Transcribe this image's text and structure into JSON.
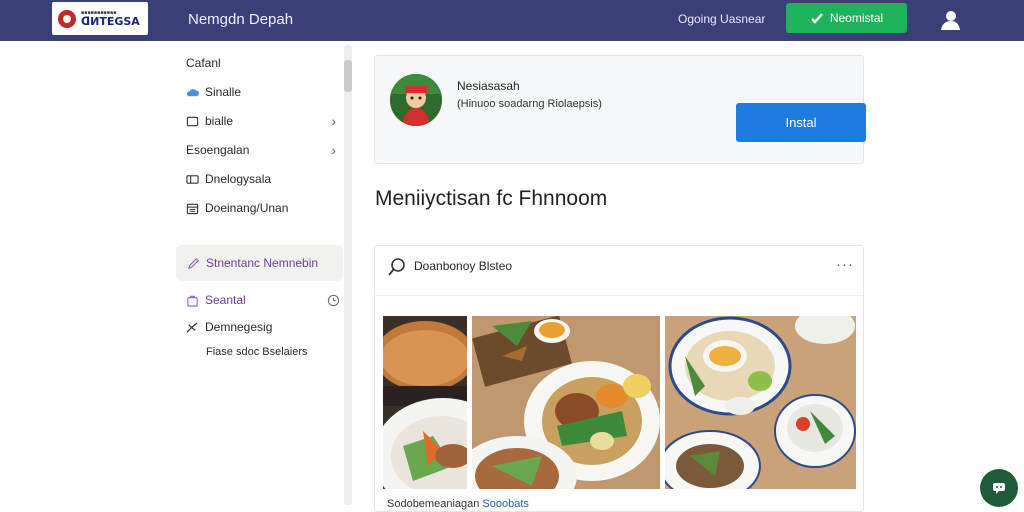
{
  "header": {
    "logo_small": "■■■■■■■■■■■",
    "logo_text": "ᗡИTEGSA",
    "title": "Nemgdn Depah",
    "link": "Ogoing Uasnear",
    "install_label": "Neomistal"
  },
  "sidebar": {
    "items": [
      {
        "label": "Cafanl"
      },
      {
        "label": "Sinalle",
        "icon": "cloud-icon"
      },
      {
        "label": "bialle",
        "icon": "square-icon",
        "chevron": true
      },
      {
        "label": "Esoengalan",
        "chevron": true
      },
      {
        "label": "Dnelogysala",
        "icon": "card-icon"
      },
      {
        "label": "Doeinang/Unan",
        "icon": "calendar-icon"
      }
    ],
    "active": {
      "label": "Stnentanc Nemnebin",
      "icon": "pencil-icon"
    },
    "lower": [
      {
        "label": "Seantal",
        "icon": "bag-icon"
      },
      {
        "label": "Demnegesig",
        "icon": "plane-icon"
      },
      {
        "label": "Fiase sdoc Bselaiers"
      }
    ]
  },
  "app_card": {
    "name": "Nesiasasah",
    "subtitle": "(Hinuoo soadarng Riolaepsis)",
    "install_label": "Instal"
  },
  "section_title": "Meniiyctisan fc Fhnnoom",
  "post": {
    "title": "Doanbonoy Blsteo",
    "more": "···",
    "footer_text": "Sodobemeaniagan",
    "footer_link": "Sooobats"
  },
  "colors": {
    "topbar": "#3b3f78",
    "install_green": "#1eb35a",
    "install_blue": "#1e7ce0",
    "active_text": "#6b3fa0"
  }
}
